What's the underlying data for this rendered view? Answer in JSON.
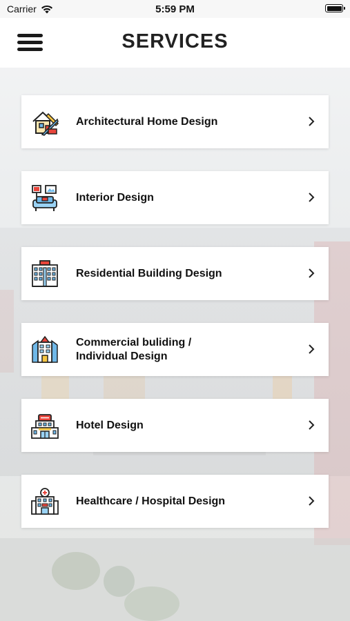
{
  "status_bar": {
    "carrier": "Carrier",
    "time": "5:59 PM"
  },
  "header": {
    "title": "SERVICES"
  },
  "services": [
    {
      "label": "Architectural Home Design",
      "icon": "architecture-house-icon"
    },
    {
      "label": "Interior Design",
      "icon": "interior-sofa-icon"
    },
    {
      "label": "Residential Building Design",
      "icon": "residential-building-icon"
    },
    {
      "label": "Commercial buliding /\nIndividual Design",
      "icon": "commercial-building-icon"
    },
    {
      "label": "Hotel Design",
      "icon": "hotel-icon"
    },
    {
      "label": "Healthcare / Hospital Design",
      "icon": "hospital-icon"
    }
  ],
  "colors": {
    "accent_red": "#e8453c",
    "accent_yellow": "#f5c542",
    "accent_blue": "#6fb8e8",
    "text": "#111111"
  }
}
